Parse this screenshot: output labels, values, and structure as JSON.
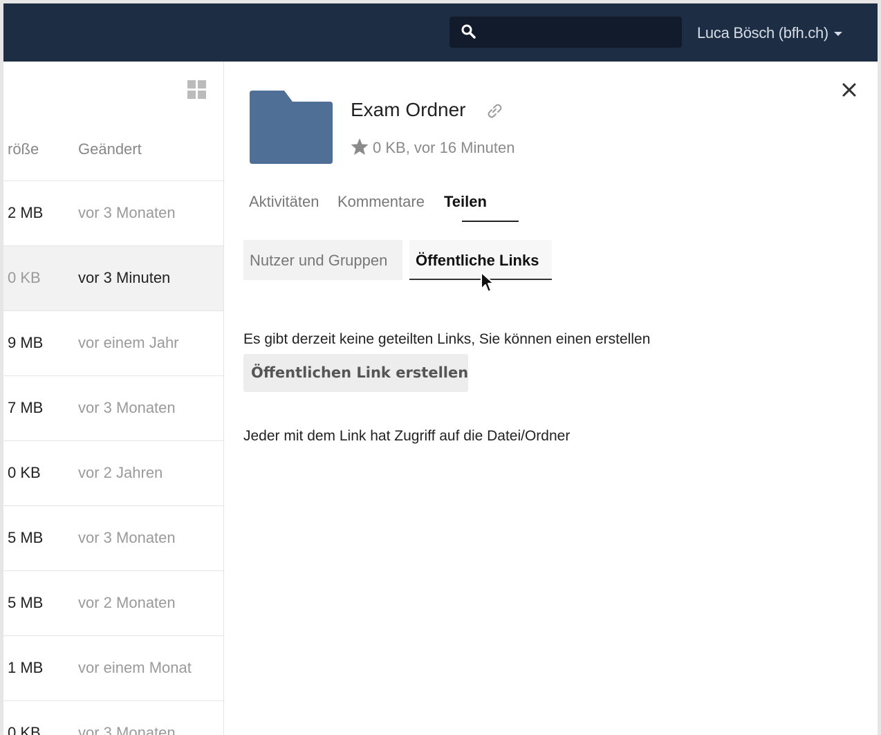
{
  "header": {
    "search_placeholder": "",
    "user_name": "Luca Bösch (bfh.ch)"
  },
  "file_list": {
    "columns": {
      "size": "röße",
      "modified": "Geändert"
    },
    "rows": [
      {
        "size": "2 MB",
        "modified": "vor 3 Monaten",
        "selected": false
      },
      {
        "size": "0 KB",
        "modified": "vor 3 Minuten",
        "selected": true
      },
      {
        "size": "9 MB",
        "modified": "vor einem Jahr",
        "selected": false
      },
      {
        "size": "7 MB",
        "modified": "vor 3 Monaten",
        "selected": false
      },
      {
        "size": "0 KB",
        "modified": "vor 2 Jahren",
        "selected": false
      },
      {
        "size": "5 MB",
        "modified": "vor 3 Monaten",
        "selected": false
      },
      {
        "size": "5 MB",
        "modified": "vor 2 Monaten",
        "selected": false
      },
      {
        "size": "1 MB",
        "modified": "vor einem Monat",
        "selected": false
      },
      {
        "size": "0 KB",
        "modified": "vor 3 Monaten",
        "selected": false
      }
    ]
  },
  "details": {
    "title": "Exam Ordner",
    "meta": "0 KB, vor 16 Minuten",
    "tabs": {
      "activities": "Aktivitäten",
      "comments": "Kommentare",
      "sharing": "Teilen"
    },
    "subtabs": {
      "users_groups": "Nutzer und Gruppen",
      "public_links": "Öffentliche Links"
    },
    "no_links_text": "Es gibt derzeit keine geteilten Links, Sie können einen erstellen",
    "create_link_button": "Öffentlichen Link erstellen",
    "access_info": "Jeder mit dem Link hat Zugriff auf die Datei/Ordner"
  },
  "colors": {
    "header_bg": "#1d2d44",
    "folder": "#4f6f96",
    "selected_row": "#f2f2f2"
  },
  "icons": [
    "search-icon",
    "grid-view-icon",
    "close-icon",
    "folder-icon",
    "link-icon",
    "star-icon",
    "mouse-cursor"
  ]
}
